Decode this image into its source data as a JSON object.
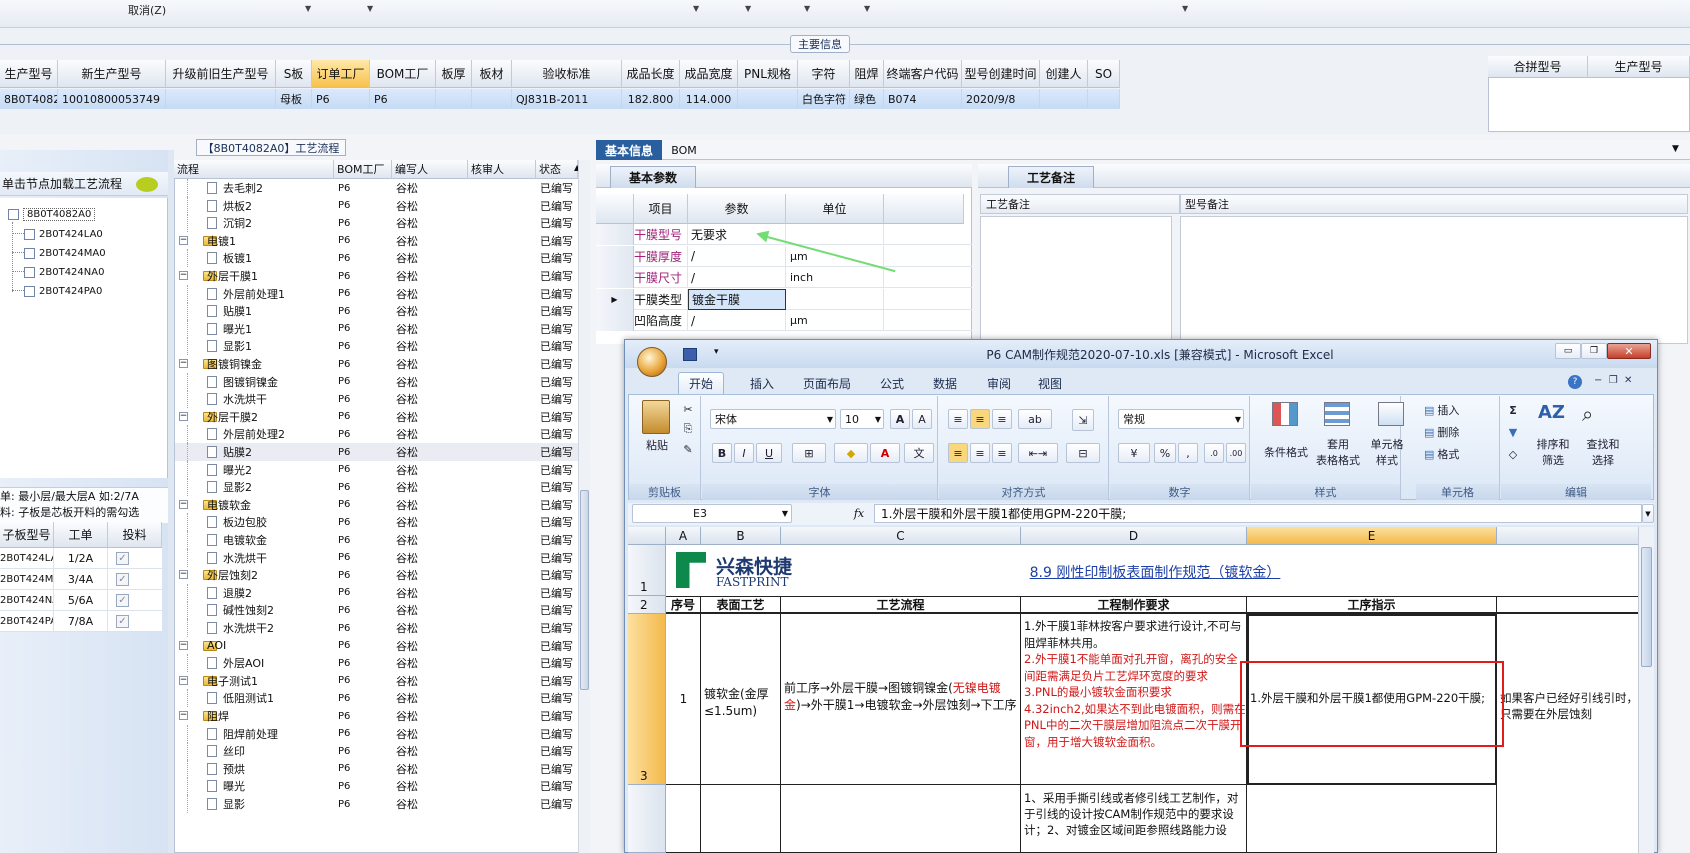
{
  "top": {
    "cancel_label": "取消(Z)"
  },
  "main_info": {
    "title": "主要信息",
    "headers": [
      "生产型号",
      "新生产型号",
      "升级前旧生产型号",
      "S板",
      "订单工厂",
      "BOM工厂",
      "板厚",
      "板材",
      "验收标准",
      "成品长度",
      "成品宽度",
      "PNL规格",
      "字符",
      "阻焊",
      "终端客户代码",
      "型号创建时间",
      "创建人",
      "SO"
    ],
    "row": [
      "8B0T4082A0",
      "10010800053749",
      "",
      "母板",
      "P6",
      "P6",
      "",
      "",
      "QJ831B-2011",
      "182.800",
      "114.000",
      "",
      "白色字符",
      "绿色",
      "B074",
      "2020/9/8",
      "",
      ""
    ],
    "side_headers": [
      "合拼型号",
      "生产型号"
    ]
  },
  "left": {
    "hint": "单击节点加载工艺流程",
    "tree_root": "8B0T4082A0",
    "tree_children": [
      "2B0T424LA0",
      "2B0T424MA0",
      "2B0T424NA0",
      "2B0T424PA0"
    ],
    "note_line1": "单: 最小层/最大层A 如:2/7A",
    "note_line2": "料: 子板是芯板开料的需勾选",
    "sub_headers": [
      "子板型号",
      "工单",
      "投料"
    ],
    "sub_rows": [
      {
        "model": "2B0T424LA0",
        "order": "1/2A"
      },
      {
        "model": "2B0T424MA0",
        "order": "3/4A"
      },
      {
        "model": "2B0T424NA0",
        "order": "5/6A"
      },
      {
        "model": "2B0T424PA0",
        "order": "7/8A"
      }
    ]
  },
  "process": {
    "title": "【8B0T4082A0】工艺流程",
    "headers": [
      "流程",
      "BOM工厂",
      "编写人",
      "核审人",
      "状态"
    ],
    "rows": [
      {
        "name": "去毛刺2",
        "folder": false
      },
      {
        "name": "烘板2",
        "folder": false
      },
      {
        "name": "沉铜2",
        "folder": false
      },
      {
        "name": "电镀1",
        "folder": true
      },
      {
        "name": "板镀1",
        "folder": false
      },
      {
        "name": "外层干膜1",
        "folder": true
      },
      {
        "name": "外层前处理1",
        "folder": false
      },
      {
        "name": "贴膜1",
        "folder": false
      },
      {
        "name": "曝光1",
        "folder": false
      },
      {
        "name": "显影1",
        "folder": false
      },
      {
        "name": "图镀铜镍金",
        "folder": true
      },
      {
        "name": "图镀铜镍金",
        "folder": false
      },
      {
        "name": "水洗烘干",
        "folder": false
      },
      {
        "name": "外层干膜2",
        "folder": true
      },
      {
        "name": "外层前处理2",
        "folder": false
      },
      {
        "name": "贴膜2",
        "folder": false
      },
      {
        "name": "曝光2",
        "folder": false
      },
      {
        "name": "显影2",
        "folder": false
      },
      {
        "name": "电镀软金",
        "folder": true
      },
      {
        "name": "板边包胶",
        "folder": false
      },
      {
        "name": "电镀软金",
        "folder": false
      },
      {
        "name": "水洗烘干",
        "folder": false
      },
      {
        "name": "外层蚀刻2",
        "folder": true
      },
      {
        "name": "退膜2",
        "folder": false
      },
      {
        "name": "碱性蚀刻2",
        "folder": false
      },
      {
        "name": "水洗烘干2",
        "folder": false
      },
      {
        "name": "AOI",
        "folder": true
      },
      {
        "name": "外层AOI",
        "folder": false
      },
      {
        "name": "电子测试1",
        "folder": true
      },
      {
        "name": "低阻测试1",
        "folder": false
      },
      {
        "name": "阻焊",
        "folder": true
      },
      {
        "name": "阻焊前处理",
        "folder": false
      },
      {
        "name": "丝印",
        "folder": false
      },
      {
        "name": "预烘",
        "folder": false
      },
      {
        "name": "曝光",
        "folder": false
      },
      {
        "name": "显影",
        "folder": false
      }
    ],
    "bom": "P6",
    "writer": "谷松",
    "status": "已编写"
  },
  "basic": {
    "tabs": [
      "基本信息",
      "BOM"
    ],
    "params_title": "基本参数",
    "remark_title": "工艺备注",
    "headers": [
      "项目",
      "参数",
      "单位"
    ],
    "rows": [
      {
        "item": "干膜型号",
        "value": "无要求",
        "unit": ""
      },
      {
        "item": "干膜厚度",
        "value": "/",
        "unit": "μm"
      },
      {
        "item": "干膜尺寸",
        "value": "/",
        "unit": "inch"
      },
      {
        "item": "干膜类型",
        "value": "镀金干膜",
        "unit": ""
      },
      {
        "item": "凹陷高度",
        "value": "/",
        "unit": "μm"
      }
    ],
    "remark_headers": [
      "工艺备注",
      "型号备注"
    ]
  },
  "excel": {
    "title": "P6 CAM制作规范2020-07-10.xls  [兼容模式] - Microsoft Excel",
    "tabs": [
      "开始",
      "插入",
      "页面布局",
      "公式",
      "数据",
      "审阅",
      "视图"
    ],
    "font_name": "宋体",
    "font_size": "10",
    "number_format": "常规",
    "groups": [
      "剪贴板",
      "字体",
      "对齐方式",
      "数字",
      "样式",
      "单元格",
      "编辑"
    ],
    "paste": "粘贴",
    "styles_buttons": [
      "条件格式",
      "套用\n表格格式",
      "单元格\n样式"
    ],
    "cell_buttons": [
      "插入",
      "删除",
      "格式"
    ],
    "edit_buttons": [
      "排序和\n筛选",
      "查找和\n选择"
    ],
    "cell_ref": "E3",
    "fx": "fx",
    "formula": "1.外层干膜和外层干膜1都使用GPM-220干膜;",
    "col_headers": [
      "A",
      "B",
      "C",
      "D",
      "E"
    ],
    "logo_cn": "兴森快捷",
    "logo_en": "FASTPRINT",
    "sheet_title": "8.9 刚性印制板表面制作规范（镀软金）",
    "row_nums": [
      "1",
      "2",
      "3"
    ],
    "headers": [
      "序号",
      "表面工艺",
      "工艺流程",
      "工程制作要求",
      "工序指示"
    ],
    "r3_seq": "1",
    "r3_surface": "镀软金(金厚≤1.5um)",
    "r3_flow_a": "前工序→外层干膜→图镀铜镍金(",
    "r3_flow_red": "无镍电镀金",
    "r3_flow_b": ")→外干膜1→电镀软金→外层蚀刻→下工序",
    "r3_req": [
      {
        "t": "1.外干膜1菲林按客户要求进行设计,不可与阻焊菲林共用。",
        "red": false
      },
      {
        "t": "2.外干膜1不能单面对孔开窗，离孔的安全间距需满足负片工艺焊环宽度的要求",
        "red": true
      },
      {
        "t": "3.PNL的最小镀软金面积要求",
        "red": true
      },
      {
        "t": "4.32inch2,如果达不到此电镀面积，则需在PNL中的二次干膜层增加阻流点二次干膜开窗，用于增大镀软金面积。",
        "red": true
      }
    ],
    "r3_instr": "1.外层干膜和外层干膜1都使用GPM-220干膜;",
    "r3_next": "如果客户已经好引线引时，只需要在外层蚀刻",
    "r4_req": "1、采用手撕引线或者修引线工艺制作，对于引线的设计按CAM制作规范中的要求设计；2、对镀金区域间距参照线路能力设"
  }
}
